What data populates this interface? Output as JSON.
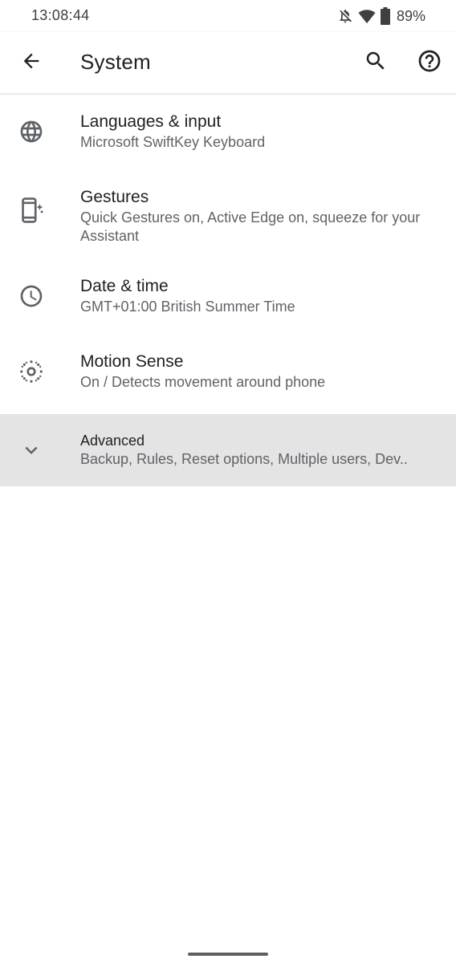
{
  "status_bar": {
    "time": "13:08:44",
    "battery_percent": "89%",
    "icons": [
      "notifications-off-icon",
      "wifi-icon",
      "battery-icon"
    ]
  },
  "app_bar": {
    "title": "System",
    "back_icon": "arrow-back-icon",
    "search_icon": "search-icon",
    "help_icon": "help-icon"
  },
  "settings": {
    "items": [
      {
        "icon": "globe-icon",
        "title": "Languages & input",
        "summary": "Microsoft SwiftKey Keyboard"
      },
      {
        "icon": "gestures-phone-icon",
        "title": "Gestures",
        "summary": "Quick Gestures on, Active Edge on, squeeze for your Assistant"
      },
      {
        "icon": "clock-icon",
        "title": "Date & time",
        "summary": "GMT+01:00 British Summer Time"
      },
      {
        "icon": "motion-sense-icon",
        "title": "Motion Sense",
        "summary": "On / Detects movement around phone"
      },
      {
        "icon": "chevron-down-icon",
        "title": "Advanced",
        "summary": "Backup, Rules, Reset options, Multiple users, Dev.."
      }
    ]
  },
  "colors": {
    "text_primary": "#202124",
    "text_secondary": "#5f6368",
    "icon": "#5f6368",
    "advanced_background": "#e4e4e4"
  }
}
